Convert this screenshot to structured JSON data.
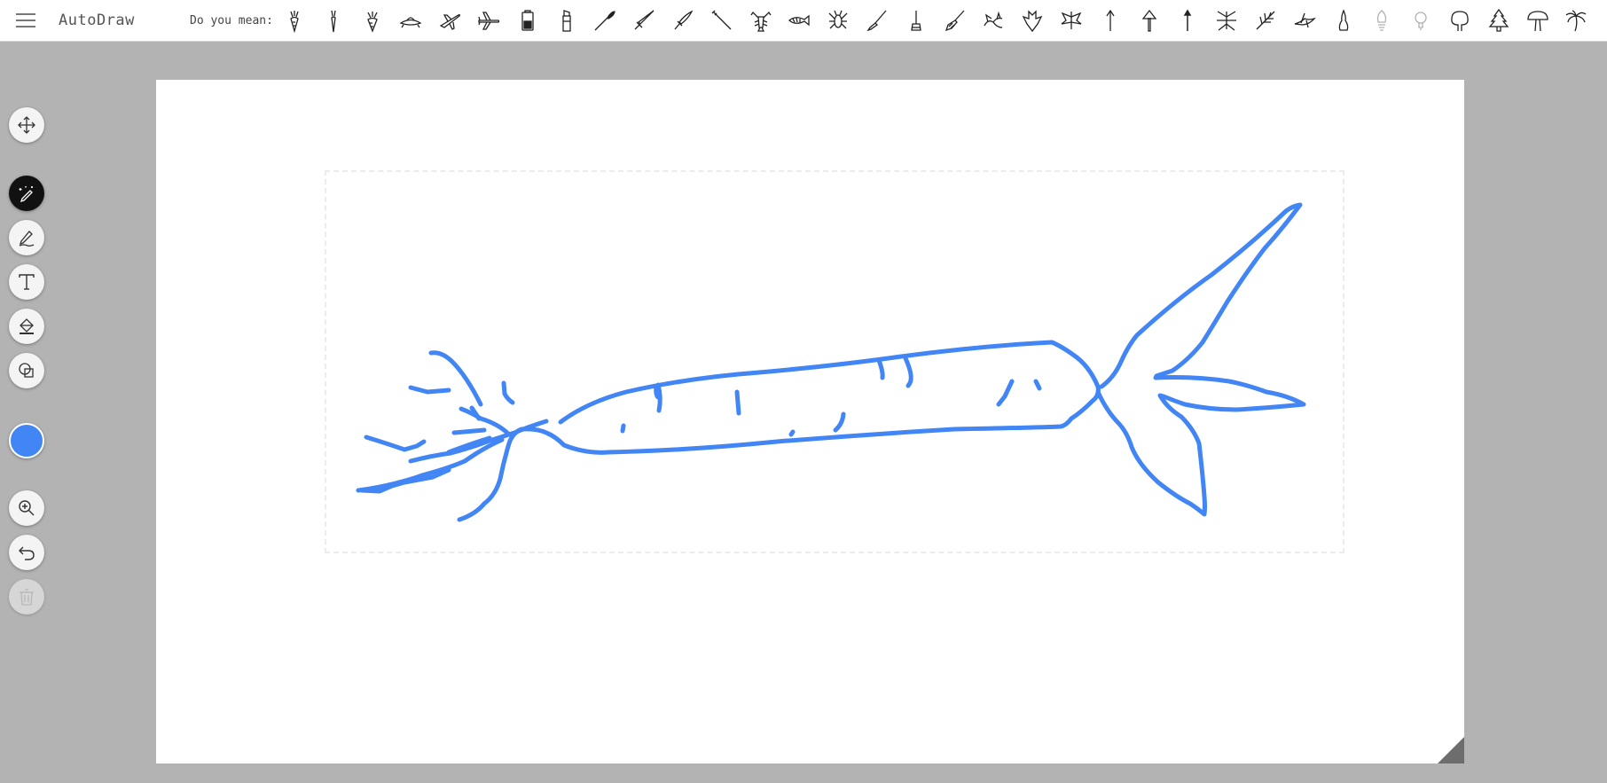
{
  "app": {
    "title": "AutoDraw"
  },
  "suggestions": {
    "label": "Do you mean:",
    "items": [
      "carrot-icon",
      "carrot-icon",
      "carrot-icon",
      "spaceship-icon",
      "airplane-icon",
      "airplane-icon",
      "battery-icon",
      "lipstick-icon",
      "paintbrush-icon",
      "sword-icon",
      "sword-icon",
      "wand-icon",
      "lobster-icon",
      "fish-icon",
      "lobster-icon",
      "brush-icon",
      "candle-icon",
      "broom-icon",
      "dragon-icon",
      "bat-icon",
      "dragon-icon",
      "arrow-up-icon",
      "arrow-up-icon",
      "arrow-up-icon",
      "insect-icon",
      "feather-icon",
      "bird-icon",
      "bowling-pin-icon",
      "lightbulb-icon",
      "lightbulb-icon",
      "tree-icon",
      "pine-tree-icon",
      "tree-icon",
      "palm-tree-icon"
    ]
  },
  "toolbar": {
    "tools": [
      {
        "name": "select-tool",
        "icon": "move-arrows-icon"
      },
      {
        "name": "autodraw-tool",
        "icon": "magic-pencil-icon",
        "active": true
      },
      {
        "name": "draw-tool",
        "icon": "pencil-icon"
      },
      {
        "name": "type-tool",
        "icon": "text-icon"
      },
      {
        "name": "fill-tool",
        "icon": "paint-bucket-icon"
      },
      {
        "name": "shape-tool",
        "icon": "shapes-icon"
      },
      {
        "name": "zoom-tool",
        "icon": "zoom-in-icon"
      },
      {
        "name": "undo-tool",
        "icon": "undo-icon"
      },
      {
        "name": "delete-tool",
        "icon": "trash-icon",
        "disabled": true
      }
    ],
    "current_color": "#4285f4"
  },
  "canvas": {
    "background": "#ffffff",
    "stroke_color": "#4285f4",
    "app_background": "#b3b3b3"
  }
}
